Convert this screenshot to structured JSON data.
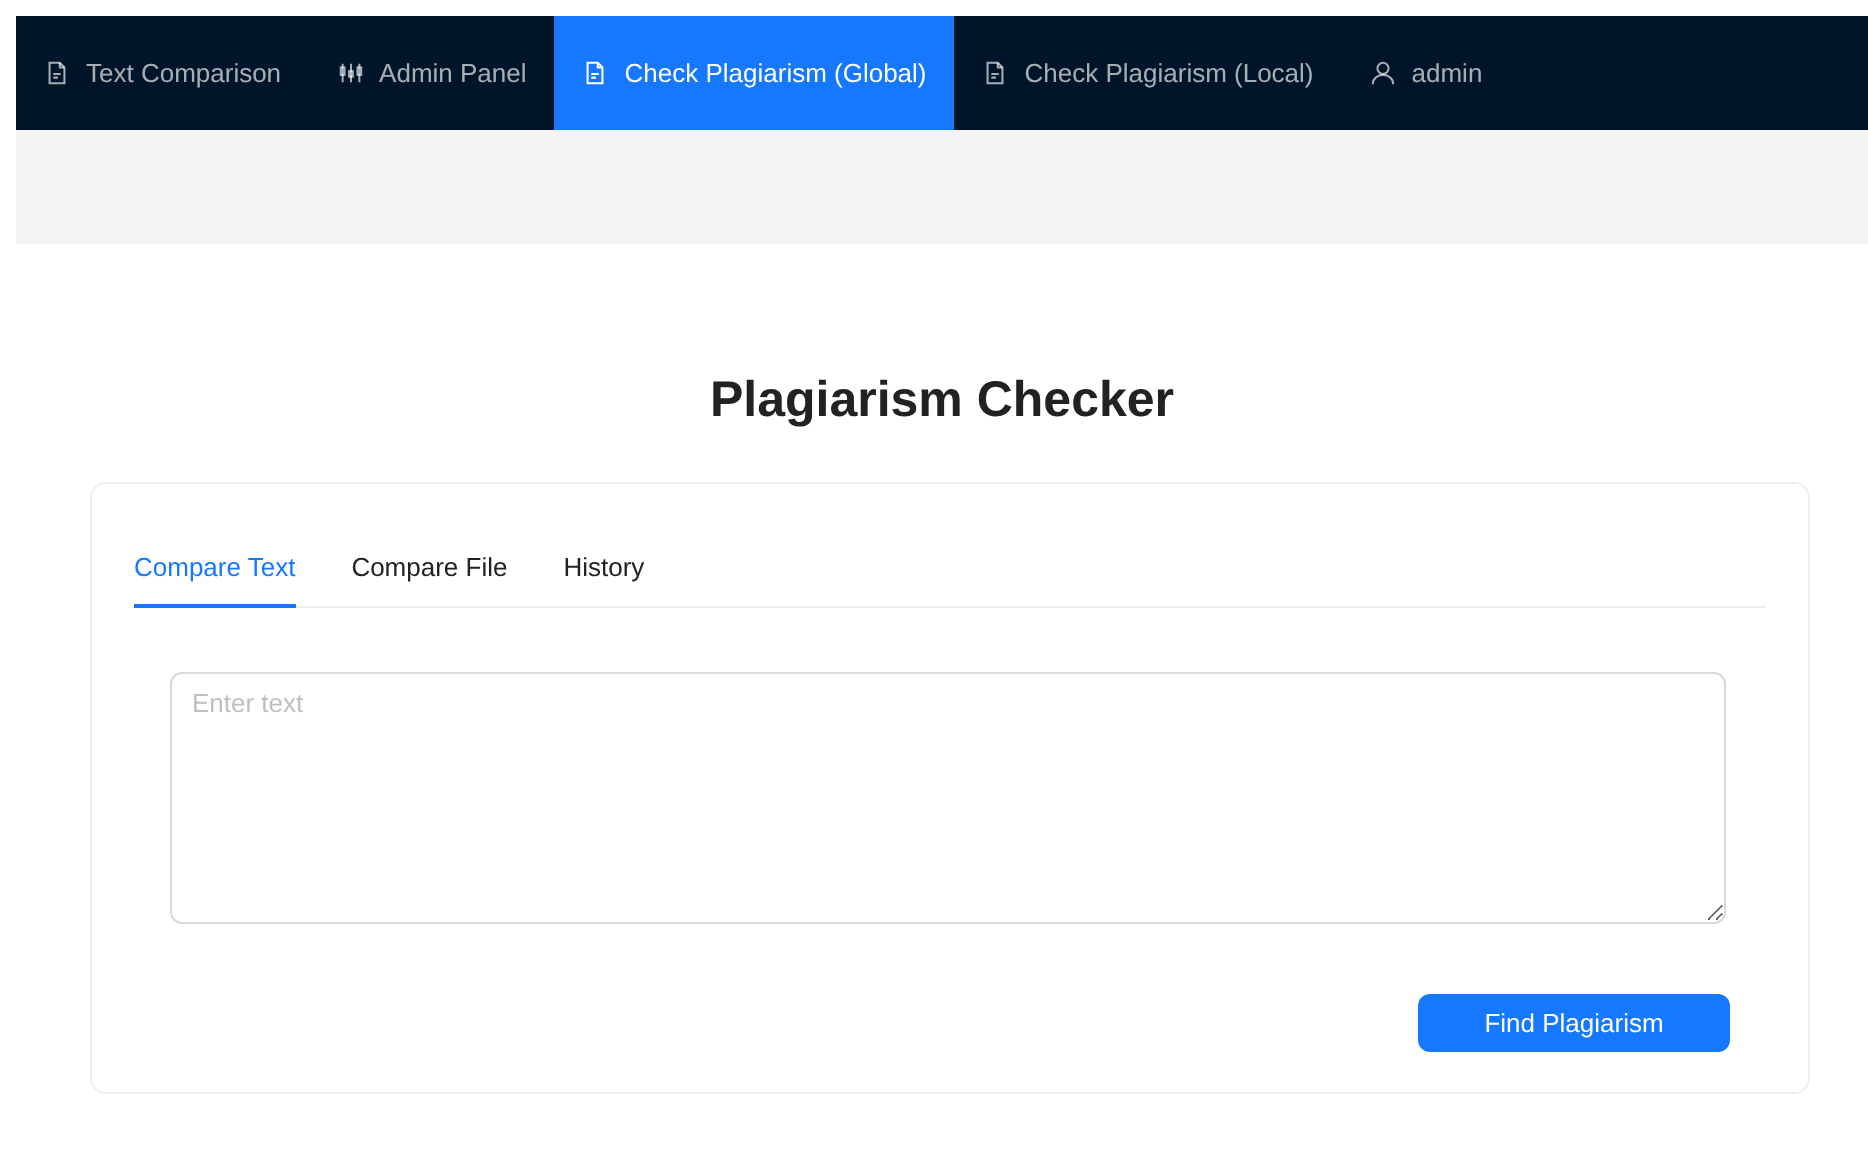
{
  "nav": [
    {
      "label": "Text Comparison",
      "kind": "page",
      "selected": false
    },
    {
      "label": "Admin Panel",
      "kind": "admin",
      "selected": false
    },
    {
      "label": "Check Plagiarism (Global)",
      "kind": "page",
      "selected": true
    },
    {
      "label": "Check Plagiarism (Local)",
      "kind": "page",
      "selected": false
    },
    {
      "label": "admin",
      "kind": "account",
      "selected": false
    }
  ],
  "title": "Plagiarism Checker",
  "tabs": [
    {
      "label": "Compare Text",
      "selected": true
    },
    {
      "label": "Compare File",
      "selected": false
    },
    {
      "label": "History",
      "selected": false
    }
  ],
  "text_area": {
    "placeholder": "Enter text"
  },
  "button": "Find Plagiarism"
}
